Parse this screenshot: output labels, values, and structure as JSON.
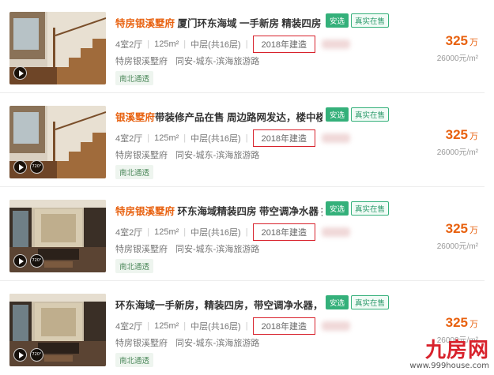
{
  "listings": [
    {
      "title_hl": "特房银溪墅府",
      "title_rest": " 厦门环东海域 一手新房 精装四房 高...",
      "badge_a": "安选",
      "badge_b": "真实在售",
      "layout": "4室2厅",
      "area": "125m²",
      "floor": "中层(共16层)",
      "built": "2018年建造",
      "community": "特房银溪墅府",
      "district": "同安-城东-滨海旅游路",
      "tag": "南北通透",
      "price": "325",
      "price_unit": "万",
      "unit_price": "26000元/m²",
      "vr_label": ""
    },
    {
      "title_hl": "银溪墅府",
      "title_rest": "带装修产品在售 周边路网发达，楼中楼好...",
      "badge_a": "安选",
      "badge_b": "真实在售",
      "layout": "4室2厅",
      "area": "125m²",
      "floor": "中层(共16层)",
      "built": "2018年建造",
      "community": "特房银溪墅府",
      "district": "同安-城东-滨海旅游路",
      "tag": "南北通透",
      "price": "325",
      "price_unit": "万",
      "unit_price": "26000元/m²",
      "vr_label": "720°"
    },
    {
      "title_hl": "特房银溪墅府",
      "title_rest": " 环东海域精装四房 带空调净水器 挑...",
      "badge_a": "安选",
      "badge_b": "真实在售",
      "layout": "4室2厅",
      "area": "125m²",
      "floor": "中层(共16层)",
      "built": "2018年建造",
      "community": "特房银溪墅府",
      "district": "同安-城东-滨海旅游路",
      "tag": "南北通透",
      "price": "325",
      "price_unit": "万",
      "unit_price": "26000元/m²",
      "vr_label": "720°"
    },
    {
      "title_hl": "",
      "title_rest": "环东海域一手新房，精装四房，带空调净水器，挑...",
      "badge_a": "安选",
      "badge_b": "真实在售",
      "layout": "4室2厅",
      "area": "125m²",
      "floor": "中层(共16层)",
      "built": "2018年建造",
      "community": "特房银溪墅府",
      "district": "同安-城东-滨海旅游路",
      "tag": "南北通透",
      "price": "325",
      "price_unit": "万",
      "unit_price": "26000元/m²",
      "vr_label": "720°"
    }
  ],
  "watermark": {
    "logo": "九房网",
    "url": "www.999house.com"
  },
  "colors": {
    "accent": "#e8610f",
    "highlight_box": "#d8222c",
    "badge_green": "#34b07a"
  }
}
